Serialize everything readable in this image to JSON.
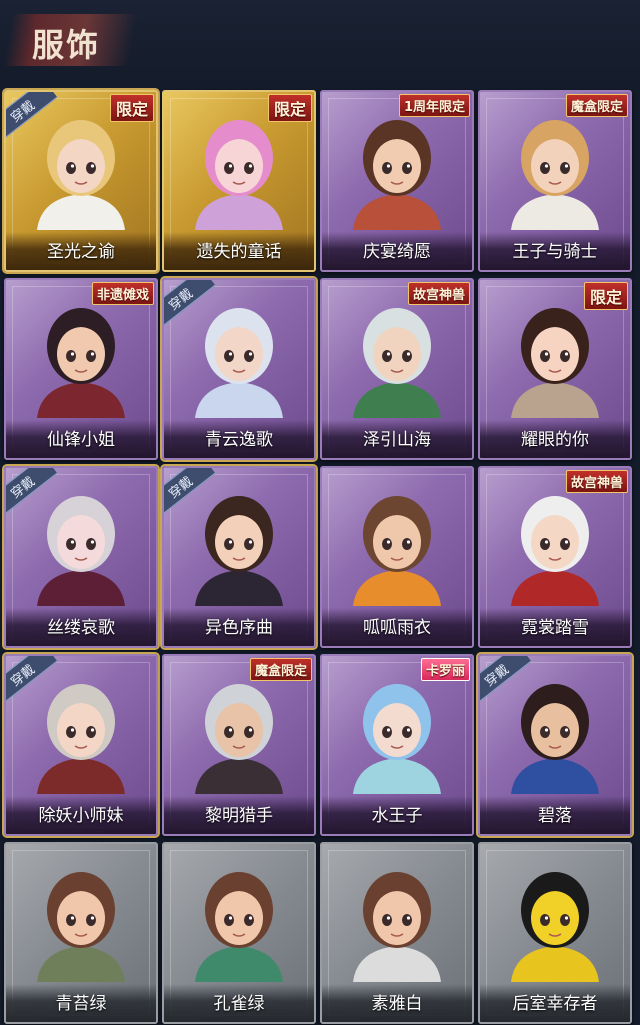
{
  "header": {
    "title": "服饰"
  },
  "colors": {
    "background": "#141b2a",
    "purple_card": "#8e6aae",
    "gold_card": "#c89a30",
    "gray_card": "#858a90",
    "limit_badge": "#c0302a"
  },
  "items": [
    {
      "name": "圣光之谕",
      "badge": "限定",
      "worn": true,
      "worn_label": "穿戴",
      "rarity": "gold",
      "hair": "#e9c77a",
      "skin": "#f3d6c4",
      "cloth": "#f2f0ea"
    },
    {
      "name": "遗失的童话",
      "badge": "限定",
      "worn": false,
      "worn_label": "",
      "rarity": "gold",
      "hair": "#e58ccc",
      "skin": "#f7d5d6",
      "cloth": "#cfa1d9"
    },
    {
      "name": "庆宴绮愿",
      "badge": "1周年限定",
      "worn": false,
      "worn_label": "",
      "rarity": "purple",
      "hair": "#5a3526",
      "skin": "#f1ccb1",
      "cloth": "#b9503a"
    },
    {
      "name": "王子与骑士",
      "badge": "魔盒限定",
      "worn": false,
      "worn_label": "",
      "rarity": "purple",
      "hair": "#d7a463",
      "skin": "#f3d2bb",
      "cloth": "#eceae3"
    },
    {
      "name": "仙锋小姐",
      "badge": "非遗傩戏",
      "worn": false,
      "worn_label": "",
      "rarity": "purple",
      "hair": "#2c1e24",
      "skin": "#f0c9ae",
      "cloth": "#7c2630"
    },
    {
      "name": "青云逸歌",
      "badge": "",
      "worn": true,
      "worn_label": "穿戴",
      "rarity": "purple",
      "hair": "#dde3ee",
      "skin": "#f2d6c7",
      "cloth": "#c9d6ee"
    },
    {
      "name": "泽引山海",
      "badge": "故宫神兽",
      "worn": false,
      "worn_label": "",
      "rarity": "purple",
      "hair": "#d8e0e2",
      "skin": "#f1d4c0",
      "cloth": "#3f7f4f"
    },
    {
      "name": "耀眼的你",
      "badge": "限定",
      "worn": false,
      "worn_label": "",
      "rarity": "purple",
      "hair": "#3a221c",
      "skin": "#f6d4c1",
      "cloth": "#b9a28e"
    },
    {
      "name": "丝缕哀歌",
      "badge": "",
      "worn": true,
      "worn_label": "穿戴",
      "rarity": "purple",
      "hair": "#d6d2d8",
      "skin": "#f4dada",
      "cloth": "#5c1f35"
    },
    {
      "name": "异色序曲",
      "badge": "",
      "worn": true,
      "worn_label": "穿戴",
      "rarity": "purple",
      "hair": "#3b2620",
      "skin": "#f3d0b9",
      "cloth": "#2c2634"
    },
    {
      "name": "呱呱雨衣",
      "badge": "",
      "worn": false,
      "worn_label": "",
      "rarity": "purple",
      "hair": "#6d4632",
      "skin": "#efc8ab",
      "cloth": "#e88d2b"
    },
    {
      "name": "霓裳踏雪",
      "badge": "故宫神兽",
      "worn": false,
      "worn_label": "",
      "rarity": "purple",
      "hair": "#eeeeee",
      "skin": "#f5d7c6",
      "cloth": "#b02828"
    },
    {
      "name": "除妖小师妹",
      "badge": "",
      "worn": true,
      "worn_label": "穿戴",
      "rarity": "purple",
      "hair": "#cfcac4",
      "skin": "#f3d6c6",
      "cloth": "#7d2a2a"
    },
    {
      "name": "黎明猎手",
      "badge": "魔盒限定",
      "worn": false,
      "worn_label": "",
      "rarity": "purple",
      "hair": "#cfd2d6",
      "skin": "#e9c3a7",
      "cloth": "#3a2f35"
    },
    {
      "name": "水王子",
      "badge": "卡罗丽",
      "worn": false,
      "worn_label": "",
      "rarity": "purple",
      "hair": "#8fc3ec",
      "skin": "#f4dbcf",
      "cloth": "#9ed3e0"
    },
    {
      "name": "碧落",
      "badge": "",
      "worn": true,
      "worn_label": "穿戴",
      "rarity": "purple",
      "hair": "#2d1d1d",
      "skin": "#e8bf9f",
      "cloth": "#2f4fa0"
    },
    {
      "name": "青苔绿",
      "badge": "",
      "worn": false,
      "worn_label": "",
      "rarity": "gray",
      "hair": "#6a4030",
      "skin": "#f0c7aa",
      "cloth": "#6f7f5a"
    },
    {
      "name": "孔雀绿",
      "badge": "",
      "worn": false,
      "worn_label": "",
      "rarity": "gray",
      "hair": "#6a4030",
      "skin": "#f0c7aa",
      "cloth": "#3f8a6a"
    },
    {
      "name": "素雅白",
      "badge": "",
      "worn": false,
      "worn_label": "",
      "rarity": "gray",
      "hair": "#6a4030",
      "skin": "#f0c7aa",
      "cloth": "#dcdcdc"
    },
    {
      "name": "后室幸存者",
      "badge": "",
      "worn": false,
      "worn_label": "",
      "rarity": "gray",
      "hair": "#1a1a1a",
      "skin": "#f1d028",
      "cloth": "#e8c51e"
    }
  ]
}
